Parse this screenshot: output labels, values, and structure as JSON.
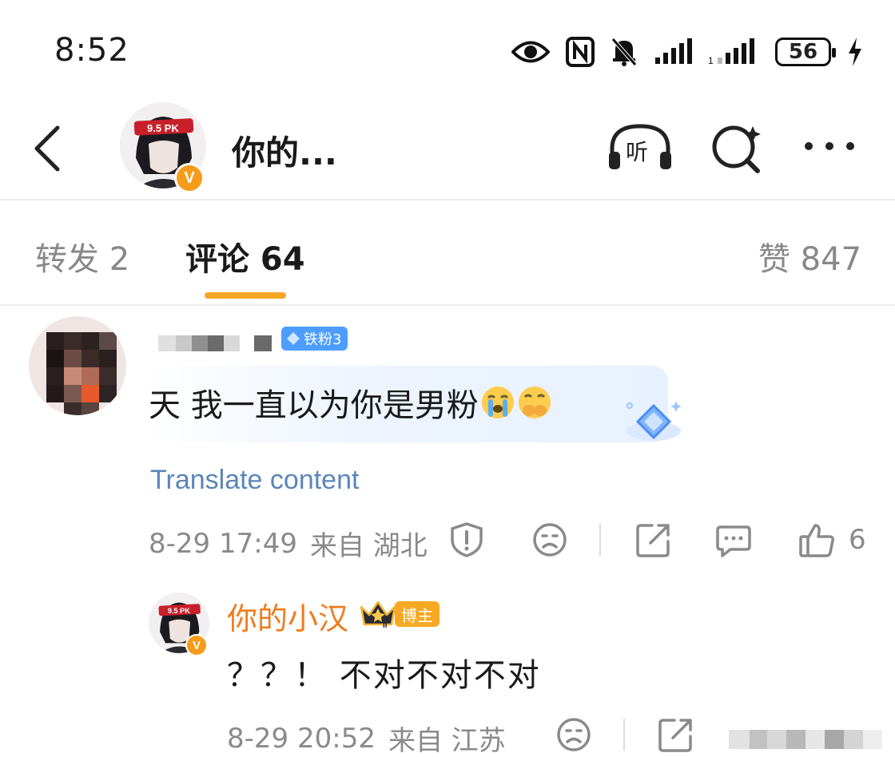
{
  "status_bar": {
    "time": "8:52",
    "battery": "56",
    "icons": [
      "eye-icon",
      "nfc-icon",
      "mute-bell-icon",
      "signal-icon",
      "signal-icon-2",
      "battery-icon",
      "charging-icon"
    ]
  },
  "header": {
    "title": "你的...",
    "avatar_text": "9.5 PK",
    "verified_badge": "V",
    "listen_label": "听",
    "icons": [
      "back-icon",
      "listen-icon",
      "search-sparkle-icon",
      "more-icon"
    ]
  },
  "tabs": {
    "repost": "转发 2",
    "comments": "评论 64",
    "likes": "赞 847",
    "active": "comments",
    "accent": "#f5a623"
  },
  "comments": [
    {
      "fan_badge": "铁粉3",
      "text": "天 我一直以为你是男粉",
      "emojis": [
        "crying-emoji",
        "covering-mouth-emoji"
      ],
      "translate_label": "Translate content",
      "time": "8-29 17:49",
      "location": "来自 湖北",
      "like_count": "6",
      "reply": {
        "name": "你的小汉",
        "badge": "博主",
        "crown_level": "II",
        "avatar_text": "9.5 PK",
        "text": "？？！ 不对不对不对",
        "time": "8-29 20:52",
        "location": "来自 江苏"
      }
    }
  ],
  "colors": {
    "name_orange": "#f07b1c",
    "fan_blue": "#4d9dff",
    "translate_blue": "#5b86b8",
    "meta_gray": "#8a8a8a"
  }
}
